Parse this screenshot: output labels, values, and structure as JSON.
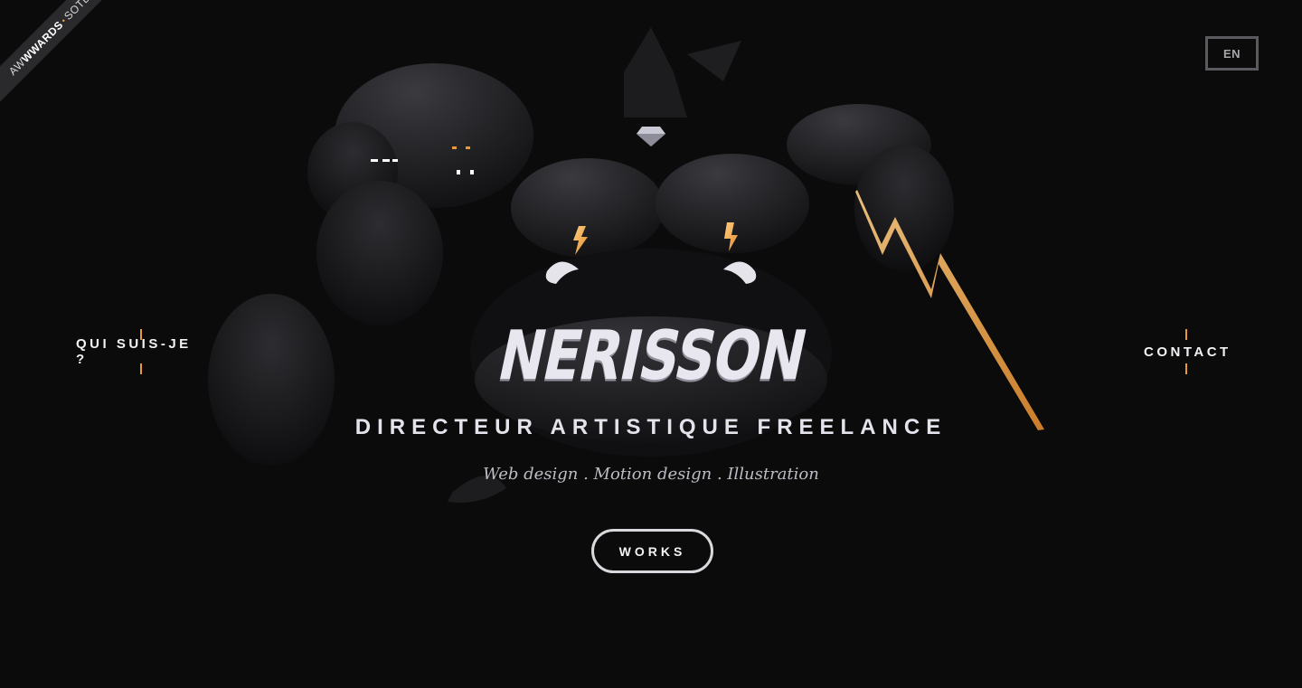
{
  "badge": {
    "part1": "AW",
    "part2": "WWARDS",
    "separator": "•",
    "part3": "SOTD"
  },
  "header": {
    "language_button": "EN"
  },
  "nav": {
    "left_label": "QUI SUIS-JE ?",
    "right_label": "CONTACT"
  },
  "hero": {
    "logo_text": "NERISSON",
    "subtitle": "DIRECTEUR ARTISTIQUE FREELANCE",
    "skills": "Web design . Motion design . Illustration",
    "cta_label": "WORKS"
  },
  "colors": {
    "background": "#0b0b0c",
    "accent": "#e79a3c",
    "text": "#f2f2f4",
    "muted_border": "#5a5a5e"
  },
  "icons": [
    "lightning-bolt-icon",
    "diamond-icon"
  ]
}
